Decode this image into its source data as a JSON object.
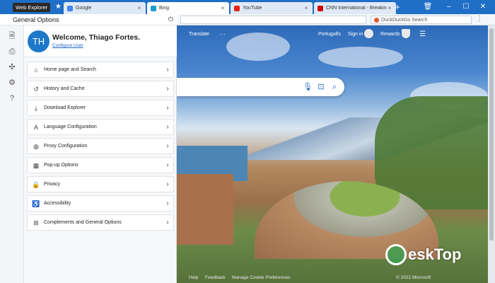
{
  "app": {
    "badge": "Web Explorer"
  },
  "tabs": [
    {
      "label": "Google",
      "favicon_color": "#4285f4",
      "active": false
    },
    {
      "label": "Bing",
      "favicon_color": "#1d9bd8",
      "active": true
    },
    {
      "label": "YouTube",
      "favicon_color": "#e62117",
      "active": false
    },
    {
      "label": "CNN International - Breaking News",
      "favicon_color": "#cc0000",
      "active": false
    }
  ],
  "addressbar": {
    "search_placeholder": "DuckDuckGo Search"
  },
  "panel": {
    "title": "General Options",
    "user": {
      "initials": "TH",
      "welcome": "Welcome, Thiago Fortes.",
      "configure_label": "Configure User"
    },
    "items": [
      {
        "label": "Home page and Search",
        "icon": "home-icon"
      },
      {
        "label": "History and Cache",
        "icon": "history-icon"
      },
      {
        "label": "Download Explorer",
        "icon": "download-icon"
      },
      {
        "label": "Language Configuration",
        "icon": "language-icon"
      },
      {
        "label": "Proxy Configuration",
        "icon": "proxy-icon"
      },
      {
        "label": "Pop-up Options",
        "icon": "popup-icon"
      },
      {
        "label": "Privacy",
        "icon": "lock-icon"
      },
      {
        "label": "Accessibility",
        "icon": "accessibility-icon"
      },
      {
        "label": "Complements and General Options",
        "icon": "extensions-icon"
      }
    ]
  },
  "bing": {
    "translate": "Translate",
    "language": "Português",
    "signin": "Sign in",
    "rewards": "Rewards",
    "footer_help": "Help",
    "footer_feedback": "Feedback",
    "footer_cookie": "Manage Cookie Preferences",
    "footer_copyright": "© 2022 Microsoft"
  },
  "watermark": {
    "text": "eskTop"
  }
}
